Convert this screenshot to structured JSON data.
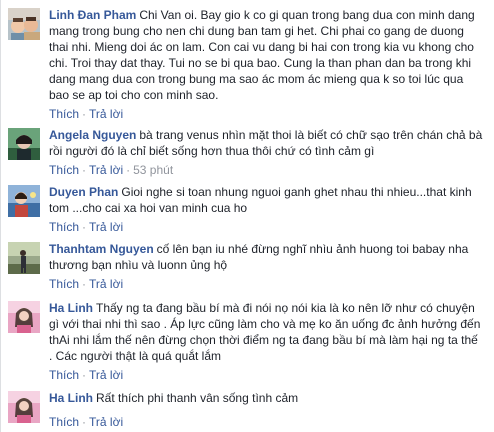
{
  "labels": {
    "like": "Thích",
    "reply": "Trả lời",
    "separator": "·"
  },
  "colors": {
    "author_link": "#365899",
    "body_text": "#1d2129",
    "meta_gray": "#90949c"
  },
  "comments": [
    {
      "author": "Linh Đan Pham",
      "text": "Chi Van oi. Bay gio k co gi quan trong bang dua con minh dang\nmang trong bung cho nen chi dung ban tam gi het. Chi phai co gang de duong\nthai nhi. Mieng doi ác on lam. Con cai vu dang bi hai con trong kia vu khong cho\nchi. Troi thay dat thay. Tui no se bi qua bao. Cung la than phan dan ba trong khi\ndang mang dua con trong bung ma sao ác mom ác mieng qua k so toi lúc qua\nbao se ap toi cho con minh sao.",
      "time": ""
    },
    {
      "author": "Angela Nguyen",
      "text": "bà trang venus nhìn mặt thoi là biết có chữ sạo trên chán chả bà\nrồi người đó là chỉ biết sống hơn thua thôi chứ có tình cảm gì",
      "time": "53 phút"
    },
    {
      "author": "Duyen Phan",
      "text": "Gioi nghe si toan nhung nguoi ganh ghet nhau thi nhieu...that kinh\ntom ...cho cai xa hoi van minh cua ho",
      "time": ""
    },
    {
      "author": "Thanhtam Nguyen",
      "text": "cố lên bạn iu nhé đừng nghĩ nhìu ảnh huong toi babay nha\nthương bạn nhìu và luonn ủng hộ",
      "time": ""
    },
    {
      "author": "Ha Linh",
      "text": "Thấy ng ta đang bầu bí mà đi nói nọ nói kia là ko nên lỡ như có chuyện\ngì với thai nhi thì sao . Áp lực cũng làm cho và mẹ ko ăn uống đc ảnh hưởng đến\nthAi nhi lắm thế nên đừng chọn thời điểm ng ta đang bầu bí mà làm hại ng ta thế\n. Các người thật là quá quắt lắm",
      "time": ""
    },
    {
      "author": "Ha Linh",
      "text": "Rất thích phi thanh vân sống tình cảm",
      "time": ""
    }
  ]
}
